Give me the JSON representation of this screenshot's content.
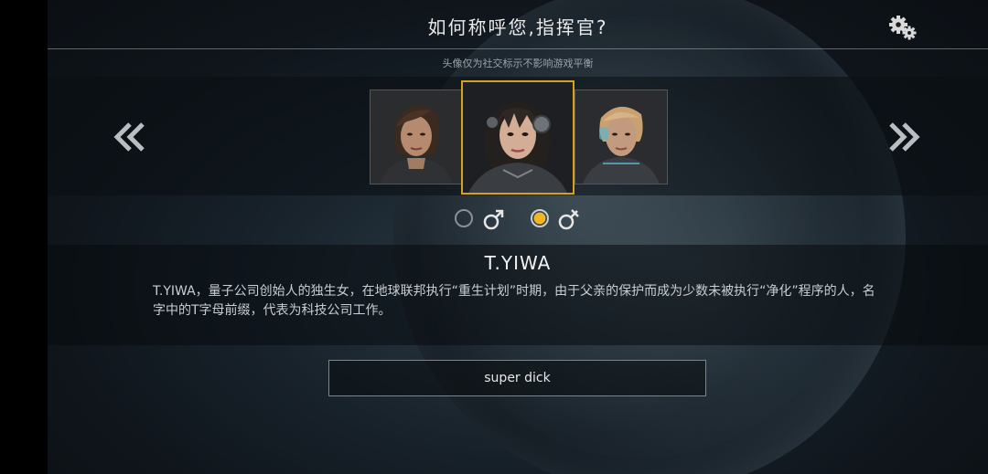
{
  "header": {
    "title": "如何称呼您,指挥官?",
    "subtitle": "头像仅为社交标示不影响游戏平衡",
    "settings_icon": "gears-icon"
  },
  "carousel": {
    "prev_icon": "double-chevron-left-icon",
    "next_icon": "double-chevron-right-icon",
    "portraits": [
      {
        "id": "portrait-left",
        "selected": false
      },
      {
        "id": "portrait-center",
        "selected": true
      },
      {
        "id": "portrait-right",
        "selected": false
      }
    ],
    "highlight_color": "#d4a21f"
  },
  "gender": {
    "options": [
      {
        "symbol": "♂",
        "icon": "male-icon",
        "selected": false
      },
      {
        "symbol": "⚦",
        "icon": "female-variant-icon",
        "selected": true
      }
    ],
    "selected_color": "#f2b624"
  },
  "character": {
    "name": "T.YIWA",
    "description": "T.YIWA，量子公司创始人的独生女，在地球联邦执行“重生计划”时期，由于父亲的保护而成为少数未被执行“净化”程序的人，名字中的T字母前缀，代表为科技公司工作。"
  },
  "name_input": {
    "value": "super dick"
  }
}
